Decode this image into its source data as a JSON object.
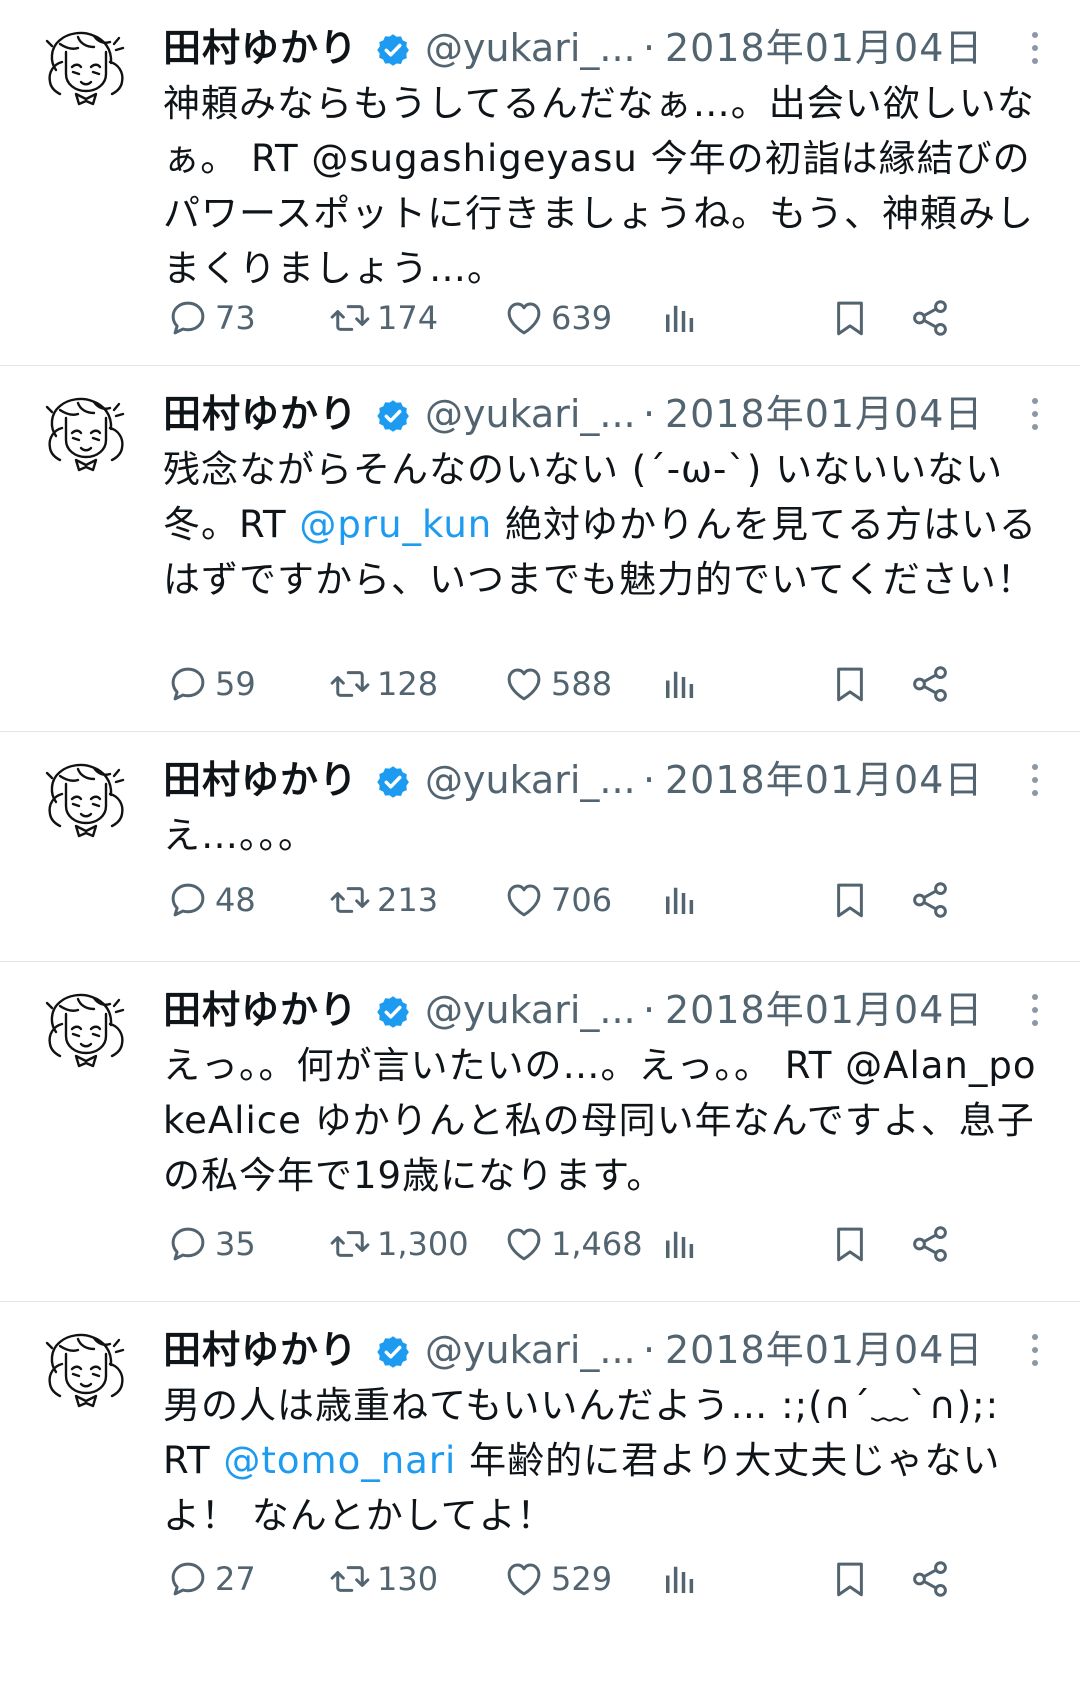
{
  "author": {
    "name": "田村ゆかり",
    "handle": "@yukari_...",
    "separator": "·"
  },
  "colors": {
    "link": "#1d9bf0",
    "verified": "#1d9bf0",
    "muted": "#536471"
  },
  "tweets": [
    {
      "date": "2018年01月04日",
      "text_parts": [
        "神頼みならもうしてるんだなぁ…。出会い欲しいなぁ。 RT @sugashigeyasu 今年の初詣は縁結びのパワースポットに行きましょうね。もう、神頼みしまくりましょう…。",
        "",
        ""
      ],
      "replies": "73",
      "retweets": "174",
      "likes": "639"
    },
    {
      "date": "2018年01月04日",
      "text_parts": [
        "残念ながらそんなのいない (´-ω-`) いないいない冬。RT ",
        "@pru_kun",
        " 絶対ゆかりんを見てる方はいるはずですから、いつまでも魅力的でいてください！"
      ],
      "replies": "59",
      "retweets": "128",
      "likes": "588"
    },
    {
      "date": "2018年01月04日",
      "text_parts": [
        "え…。。。",
        "",
        ""
      ],
      "replies": "48",
      "retweets": "213",
      "likes": "706"
    },
    {
      "date": "2018年01月04日",
      "text_parts": [
        "えっ。。何が言いたいの…。えっ。。 RT @Alan_pokeAlice ゆかりんと私の母同い年なんですよ、息子の私今年で19歳になります。",
        "",
        ""
      ],
      "replies": "35",
      "retweets": "1,300",
      "likes": "1,468"
    },
    {
      "date": "2018年01月04日",
      "text_parts": [
        "男の人は歳重ねてもいいんだよう… :;(∩´﹏`∩);:\nRT ",
        "@tomo_nari",
        " 年齢的に君より大丈夫じゃないよ！ なんとかしてよ！"
      ],
      "replies": "27",
      "retweets": "130",
      "likes": "529"
    }
  ]
}
